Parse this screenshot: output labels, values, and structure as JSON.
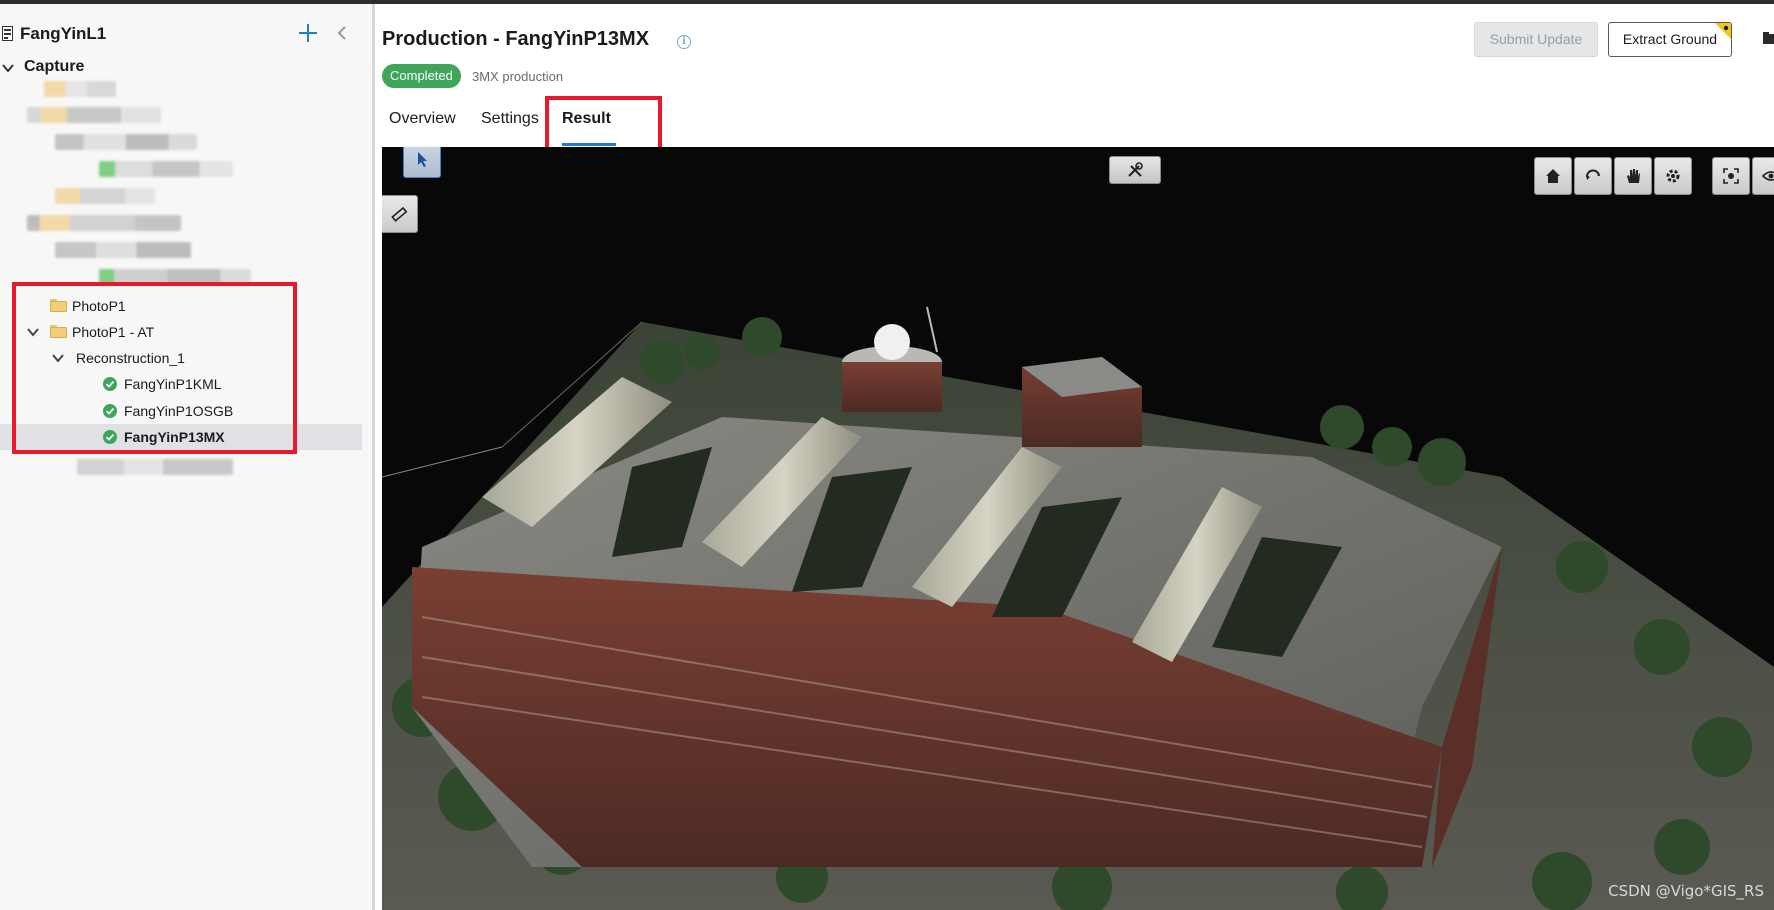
{
  "project": {
    "title": "FangYinL1"
  },
  "tree": {
    "root_label": "Capture",
    "items": [
      {
        "label": "PhotoP1"
      },
      {
        "label": "PhotoP1 - AT"
      },
      {
        "label": "Reconstruction_1"
      },
      {
        "label": "FangYinP1KML"
      },
      {
        "label": "FangYinP1OSGB"
      },
      {
        "label": "FangYinP13MX"
      }
    ]
  },
  "header": {
    "title": "Production -  FangYinP13MX",
    "status": "Completed",
    "subtitle": "3MX production",
    "submit_label": "Submit Update",
    "extract_label": "Extract Ground"
  },
  "tabs": [
    {
      "label": "Overview"
    },
    {
      "label": "Settings"
    },
    {
      "label": "Result"
    }
  ],
  "viewer": {
    "watermark": "CSDN @Vigo*GIS_RS",
    "tools": [
      "select-icon",
      "measure-icon",
      "tools-icon",
      "home-icon",
      "orbit-icon",
      "pan-icon",
      "settings-icon",
      "focus-icon",
      "eye-icon"
    ]
  },
  "colors": {
    "accent": "#1c7fd6",
    "status_green": "#3fa55b",
    "highlight_red": "#e8192c"
  }
}
